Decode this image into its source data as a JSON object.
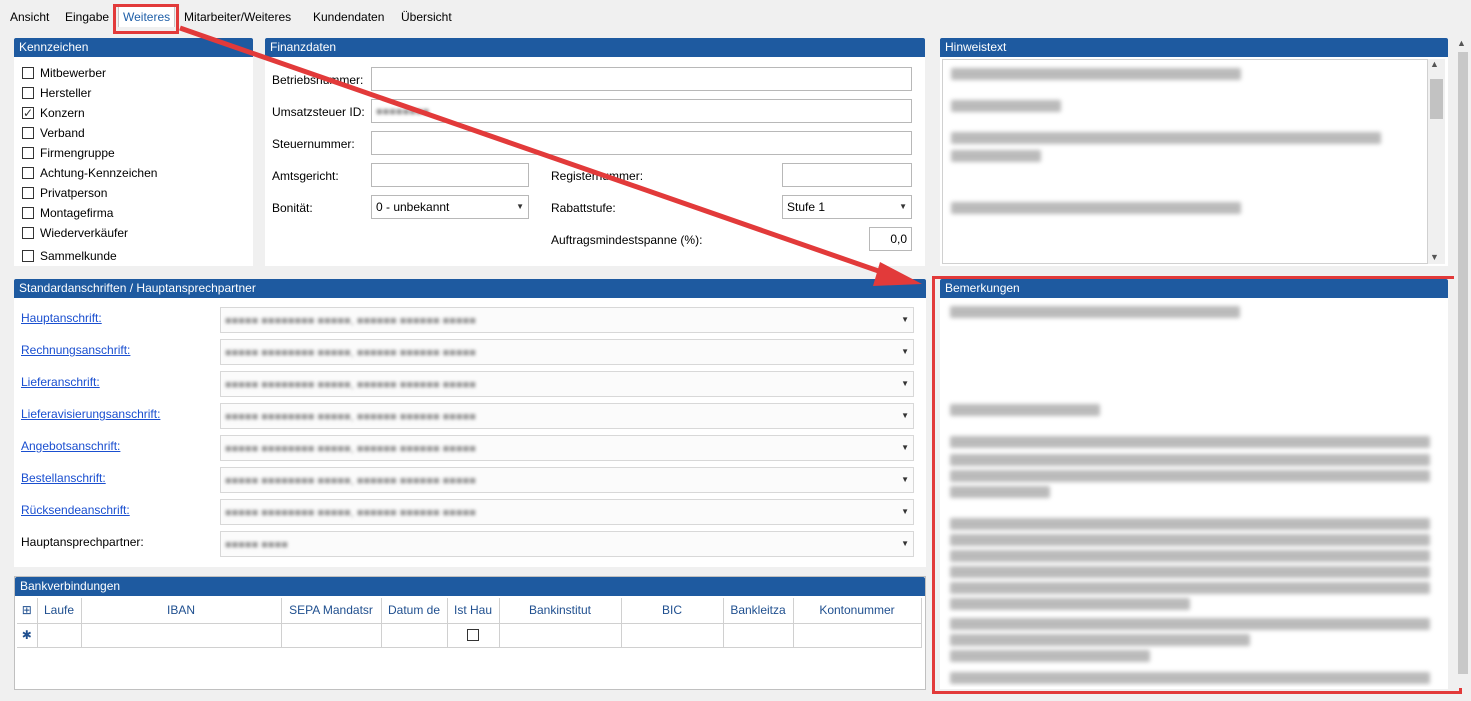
{
  "tabs": [
    "Ansicht",
    "Eingabe",
    "Weiteres",
    "Mitarbeiter/Weiteres",
    "Kundendaten",
    "Übersicht"
  ],
  "active_tab": "Weiteres",
  "kennzeichen": {
    "title": "Kennzeichen",
    "items": [
      {
        "label": "Mitbewerber",
        "checked": false
      },
      {
        "label": "Hersteller",
        "checked": false
      },
      {
        "label": "Konzern",
        "checked": true
      },
      {
        "label": "Verband",
        "checked": false
      },
      {
        "label": "Firmengruppe",
        "checked": false
      },
      {
        "label": "Achtung-Kennzeichen",
        "checked": false
      },
      {
        "label": "Privatperson",
        "checked": false
      },
      {
        "label": "Montagefirma",
        "checked": false
      },
      {
        "label": "Wiederverkäufer",
        "checked": false
      },
      {
        "label": "Sammelkunde",
        "checked": false
      }
    ]
  },
  "finanzdaten": {
    "title": "Finanzdaten",
    "betriebsnummer_label": "Betriebsnummer:",
    "ust_label": "Umsatzsteuer ID:",
    "steuernummer_label": "Steuernummer:",
    "amtsgericht_label": "Amtsgericht:",
    "registernummer_label": "Registernummer:",
    "bonitaet_label": "Bonität:",
    "bonitaet_value": "0 - unbekannt",
    "rabattstufe_label": "Rabattstufe:",
    "rabattstufe_value": "Stufe 1",
    "auftragsmindestspanne_label": "Auftragsmindestspanne (%):",
    "auftragsmindestspanne_value": "0,0"
  },
  "hinweistext": {
    "title": "Hinweistext"
  },
  "standardanschriften": {
    "title": "Standardanschriften / Hauptansprechpartner",
    "rows": [
      {
        "label": "Hauptanschrift:",
        "link": true
      },
      {
        "label": "Rechnungsanschrift:",
        "link": true
      },
      {
        "label": "Lieferanschrift:",
        "link": true
      },
      {
        "label": "Lieferavisierungsanschrift:",
        "link": true
      },
      {
        "label": "Angebotsanschrift:",
        "link": true
      },
      {
        "label": "Bestellanschrift:",
        "link": true
      },
      {
        "label": "Rücksendeanschrift:",
        "link": true
      },
      {
        "label": "Hauptansprechpartner:",
        "link": false
      }
    ]
  },
  "bankverbindungen": {
    "title": "Bankverbindungen",
    "columns": [
      "Laufe",
      "IBAN",
      "SEPA Mandatsr",
      "Datum de",
      "Ist Hau",
      "Bankinstitut",
      "BIC",
      "Bankleitza",
      "Kontonummer"
    ]
  },
  "bemerkungen": {
    "title": "Bemerkungen"
  },
  "colors": {
    "header_blue": "#1e5aa0",
    "highlight_red": "#e23a3a",
    "link_blue": "#1a4fd0"
  }
}
